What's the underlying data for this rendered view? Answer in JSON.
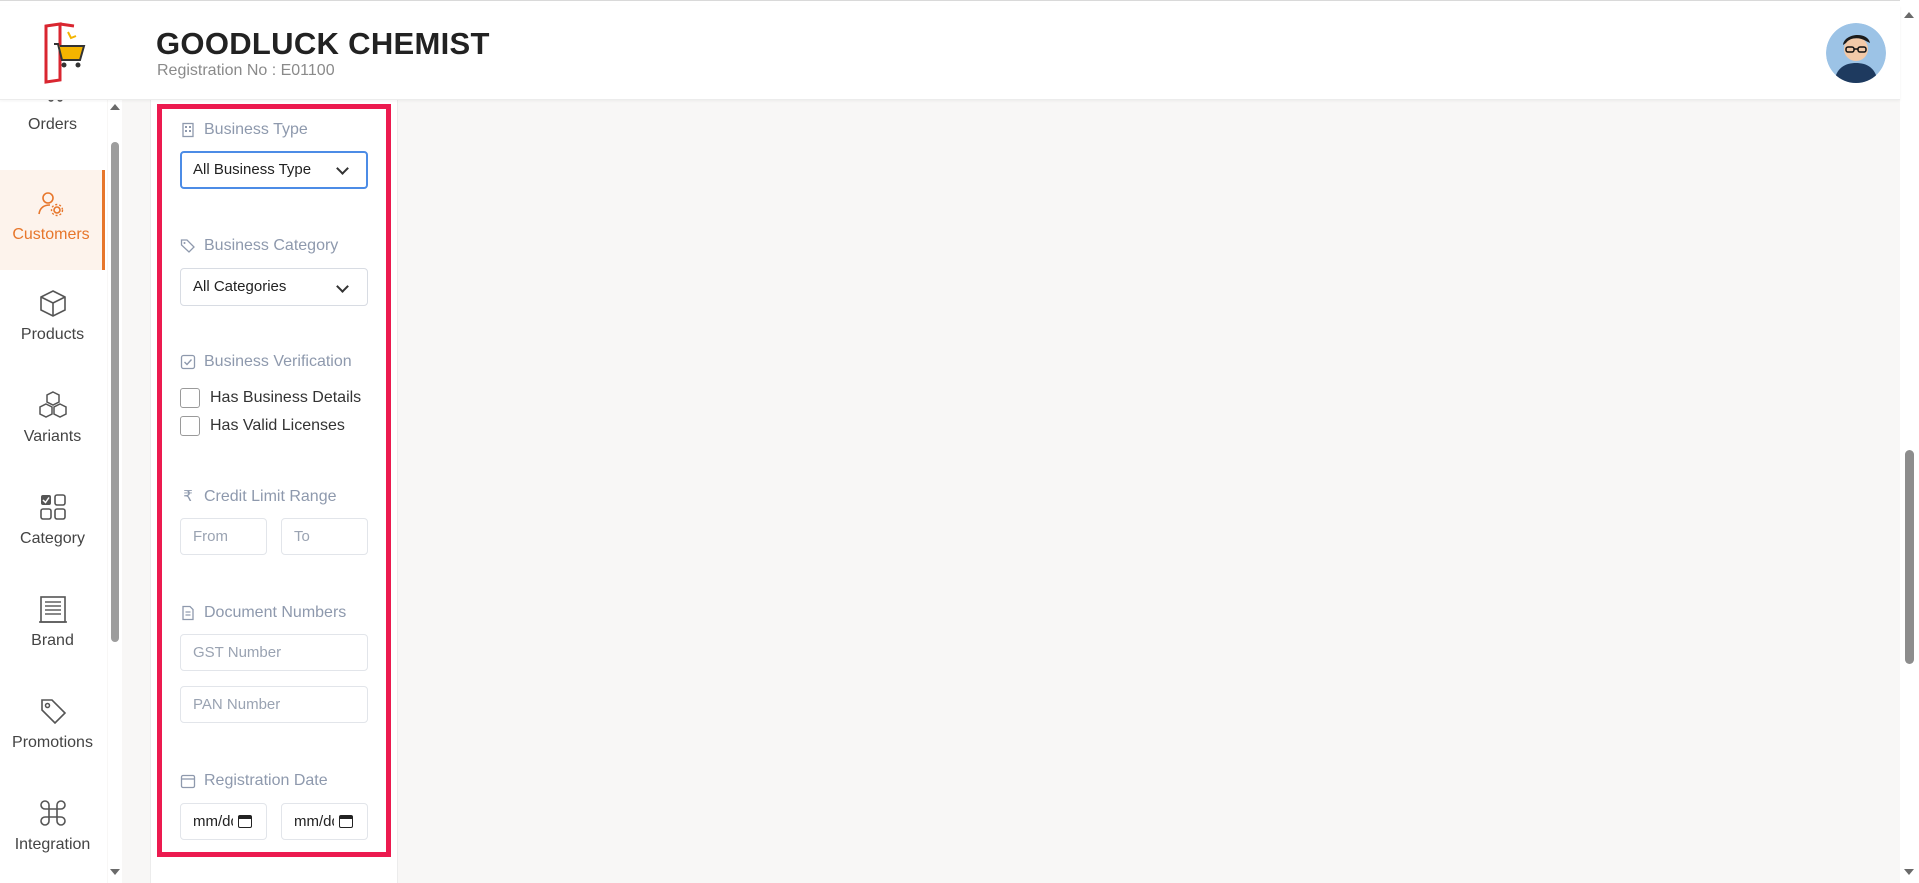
{
  "header": {
    "store_name": "GOODLUCK CHEMIST",
    "registration": "Registration No : E01100",
    "accent_color": "#e7762b"
  },
  "sidebar": {
    "items": [
      {
        "label": "Orders",
        "icon": "cart-icon",
        "active": false
      },
      {
        "label": "Customers",
        "icon": "user-gear-icon",
        "active": true
      },
      {
        "label": "Products",
        "icon": "box-icon",
        "active": false
      },
      {
        "label": "Variants",
        "icon": "boxes-icon",
        "active": false
      },
      {
        "label": "Category",
        "icon": "grid-icon",
        "active": false
      },
      {
        "label": "Brand",
        "icon": "building-icon",
        "active": false
      },
      {
        "label": "Promotions",
        "icon": "tag-icon",
        "active": false
      },
      {
        "label": "Integration",
        "icon": "command-icon",
        "active": false
      }
    ]
  },
  "filters": {
    "highlight_color": "#ec1a4f",
    "business_type": {
      "label": "Business Type",
      "selected": "All Business Type"
    },
    "business_category": {
      "label": "Business Category",
      "selected": "All Categories"
    },
    "business_verification": {
      "label": "Business Verification",
      "options": [
        "Has Business Details",
        "Has Valid Licenses"
      ]
    },
    "credit_limit": {
      "label": "Credit Limit Range",
      "currency": "₹",
      "from_placeholder": "From",
      "to_placeholder": "To"
    },
    "documents": {
      "label": "Document Numbers",
      "gst_placeholder": "GST Number",
      "pan_placeholder": "PAN Number"
    },
    "registration_date": {
      "label": "Registration Date",
      "from_value": "mm/dd",
      "to_value": "mm/dd"
    }
  }
}
